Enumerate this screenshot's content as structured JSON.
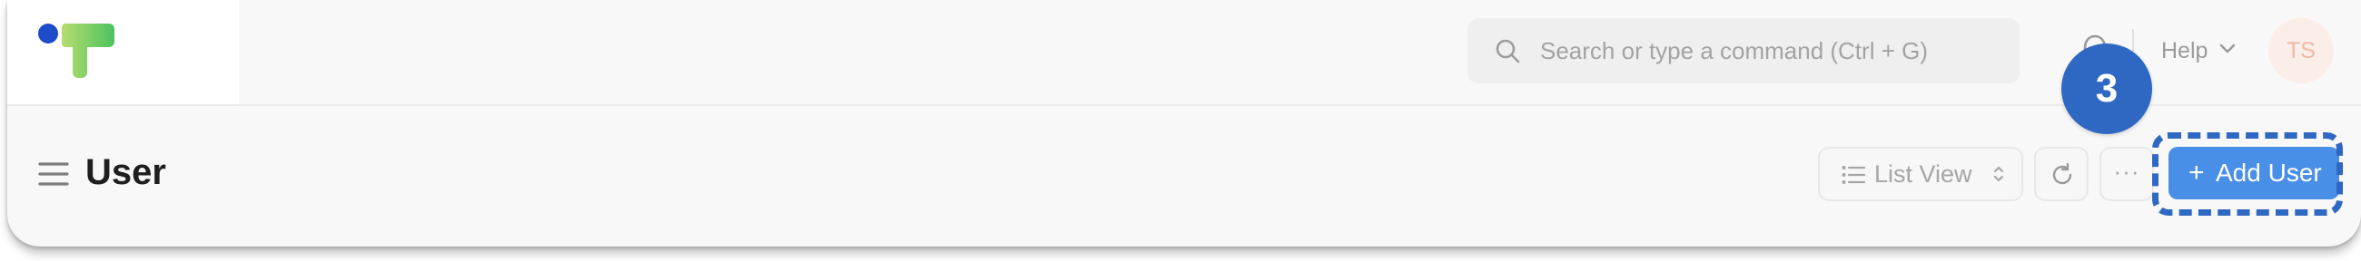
{
  "colors": {
    "accent_blue": "#4a8fe7",
    "annotation_blue": "#2f68c2",
    "logo_dot": "#1e4cc8",
    "logo_green_light": "#b6dd6f",
    "logo_green_dark": "#4cc25f"
  },
  "navbar": {
    "logo_icon": "app-logo",
    "search": {
      "icon": "search-icon",
      "placeholder": "Search or type a command (Ctrl + G)"
    },
    "notification_icon": "bell-icon",
    "help_label": "Help",
    "avatar_initials": "TS"
  },
  "page_head": {
    "menu_icon": "hamburger-icon",
    "title": "User",
    "list_view_label": "List View",
    "refresh_icon": "refresh-icon",
    "more_label": "···",
    "add_button": {
      "plus": "+",
      "label": "Add User"
    }
  },
  "annotation": {
    "step_number": "3"
  }
}
